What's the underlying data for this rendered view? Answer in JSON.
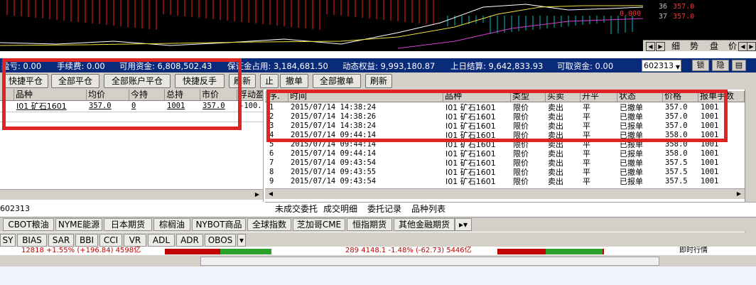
{
  "quote": {
    "rows": [
      {
        "n": "36",
        "v": "357.0"
      },
      {
        "n": "37",
        "v": "357.0"
      }
    ],
    "chart_zero": "0.000",
    "tabs": [
      "细",
      "势",
      "盘",
      "价"
    ]
  },
  "account": {
    "profit": "盈亏: 0.00",
    "fee": "手续费: 0.00",
    "available": "可用资金: 6,808,502.43",
    "margin": "保证金占用: 3,184,681.50",
    "equity": "动态权益: 9,993,180.87",
    "prev_settle": "上日结算: 9,642,833.93",
    "withdrawable": "可取资金: 0.00",
    "account_no": "602313",
    "lock_label": "锁",
    "hide_label": "隐"
  },
  "toolbar": {
    "quick_close": "快捷平仓",
    "close_all": "全部平仓",
    "close_all_accounts": "全部账户平仓",
    "quick_reverse": "快捷反手",
    "refresh_left": "刷新",
    "stop": "止",
    "cancel": "撤单",
    "cancel_all": "全部撤单",
    "refresh_right": "刷新"
  },
  "positions": {
    "headers": [
      "品种",
      "均价",
      "今持",
      "总持",
      "市价",
      "浮动盈"
    ],
    "rows": [
      [
        "I01 矿石1601",
        "357.0",
        "0",
        "1001",
        "357.0",
        "-100."
      ]
    ],
    "account_code": "602313"
  },
  "orders": {
    "headers": [
      "序.",
      "时间",
      "品种",
      "类型",
      "买卖",
      "开平",
      "状态",
      "价格",
      "报单手数"
    ],
    "rows": [
      [
        "1",
        "2015/07/14 14:38:24",
        "I01 矿石1601",
        "限价",
        "卖出",
        "平",
        "已撤单",
        "357.0",
        "1001"
      ],
      [
        "2",
        "2015/07/14 14:38:26",
        "I01 矿石1601",
        "限价",
        "卖出",
        "平",
        "已撤单",
        "357.0",
        "1001"
      ],
      [
        "3",
        "2015/07/14 14:38:24",
        "I01 矿石1601",
        "限价",
        "卖出",
        "平",
        "已报单",
        "357.0",
        "1001"
      ],
      [
        "4",
        "2015/07/14 09:44:14",
        "I01 矿石1601",
        "限价",
        "卖出",
        "平",
        "已撤单",
        "358.0",
        "1001"
      ],
      [
        "5",
        "2015/07/14 09:44:14",
        "I01 矿石1601",
        "限价",
        "卖出",
        "平",
        "已报单",
        "358.0",
        "1001"
      ],
      [
        "6",
        "2015/07/14 09:44:14",
        "I01 矿石1601",
        "限价",
        "卖出",
        "平",
        "已报单",
        "358.0",
        "1001"
      ],
      [
        "7",
        "2015/07/14 09:43:54",
        "I01 矿石1601",
        "限价",
        "卖出",
        "平",
        "已撤单",
        "357.5",
        "1001"
      ],
      [
        "8",
        "2015/07/14 09:43:55",
        "I01 矿石1601",
        "限价",
        "卖出",
        "平",
        "已撤单",
        "357.5",
        "1001"
      ],
      [
        "9",
        "2015/07/14 09:43:54",
        "I01 矿石1601",
        "限价",
        "卖出",
        "平",
        "已报单",
        "357.5",
        "1001"
      ]
    ]
  },
  "bottom_tabs": [
    "未成交委托",
    "成交明细",
    "委托记录",
    "品种列表"
  ],
  "market_tabs": [
    "CBOT粮油",
    "NYME能源",
    "日本期货",
    "棕榈油",
    "NYBOT商品",
    "全球指数",
    "芝加哥CME",
    "恒指期货",
    "其他金融期货"
  ],
  "indicator_tabs": [
    "SY",
    "BIAS",
    "SAR",
    "BBI",
    "CCI",
    "VR",
    "ADL",
    "ADR",
    "OBOS"
  ],
  "ticker": {
    "left": "12818  +1.55%  (+196.84)  4598亿",
    "right": "289  4148.1  -1.48%  (-62.73)  5446亿",
    "right_label": "即时行情"
  },
  "colors": {
    "highlight": "#e02424",
    "info_bar": "#0a2a7a",
    "chart_bg": "#000000",
    "up": "#ff3030",
    "down": "#00d0d0"
  }
}
